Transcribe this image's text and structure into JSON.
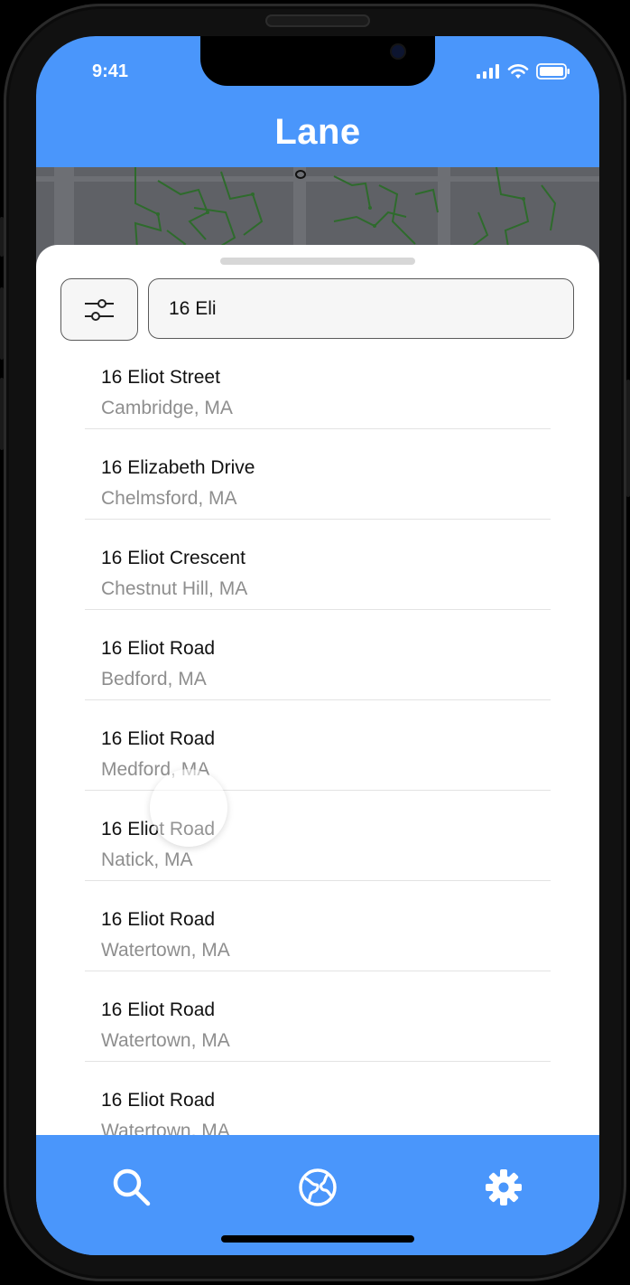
{
  "status": {
    "time": "9:41"
  },
  "app": {
    "title": "Lane"
  },
  "search": {
    "value": "16 Eli",
    "filter_icon": "sliders-icon"
  },
  "results": [
    {
      "street": "16 Eliot Street",
      "city": "Cambridge, MA"
    },
    {
      "street": "16 Elizabeth Drive",
      "city": "Chelmsford, MA"
    },
    {
      "street": "16 Eliot Crescent",
      "city": "Chestnut Hill, MA"
    },
    {
      "street": "16 Eliot Road",
      "city": "Bedford, MA"
    },
    {
      "street": "16 Eliot Road",
      "city": "Medford, MA"
    },
    {
      "street": "16 Eliot Road",
      "city": "Natick, MA"
    },
    {
      "street": "16 Eliot Road",
      "city": "Watertown, MA"
    },
    {
      "street": "16 Eliot Road",
      "city": "Watertown, MA"
    },
    {
      "street": "16 Eliot Road",
      "city": "Watertown, MA"
    }
  ],
  "tabs": [
    {
      "icon": "search-icon"
    },
    {
      "icon": "globe-icon"
    },
    {
      "icon": "gear-icon"
    }
  ],
  "colors": {
    "brand": "#4a96fb",
    "map": "#5f6166",
    "road": "#2d5e2b"
  }
}
